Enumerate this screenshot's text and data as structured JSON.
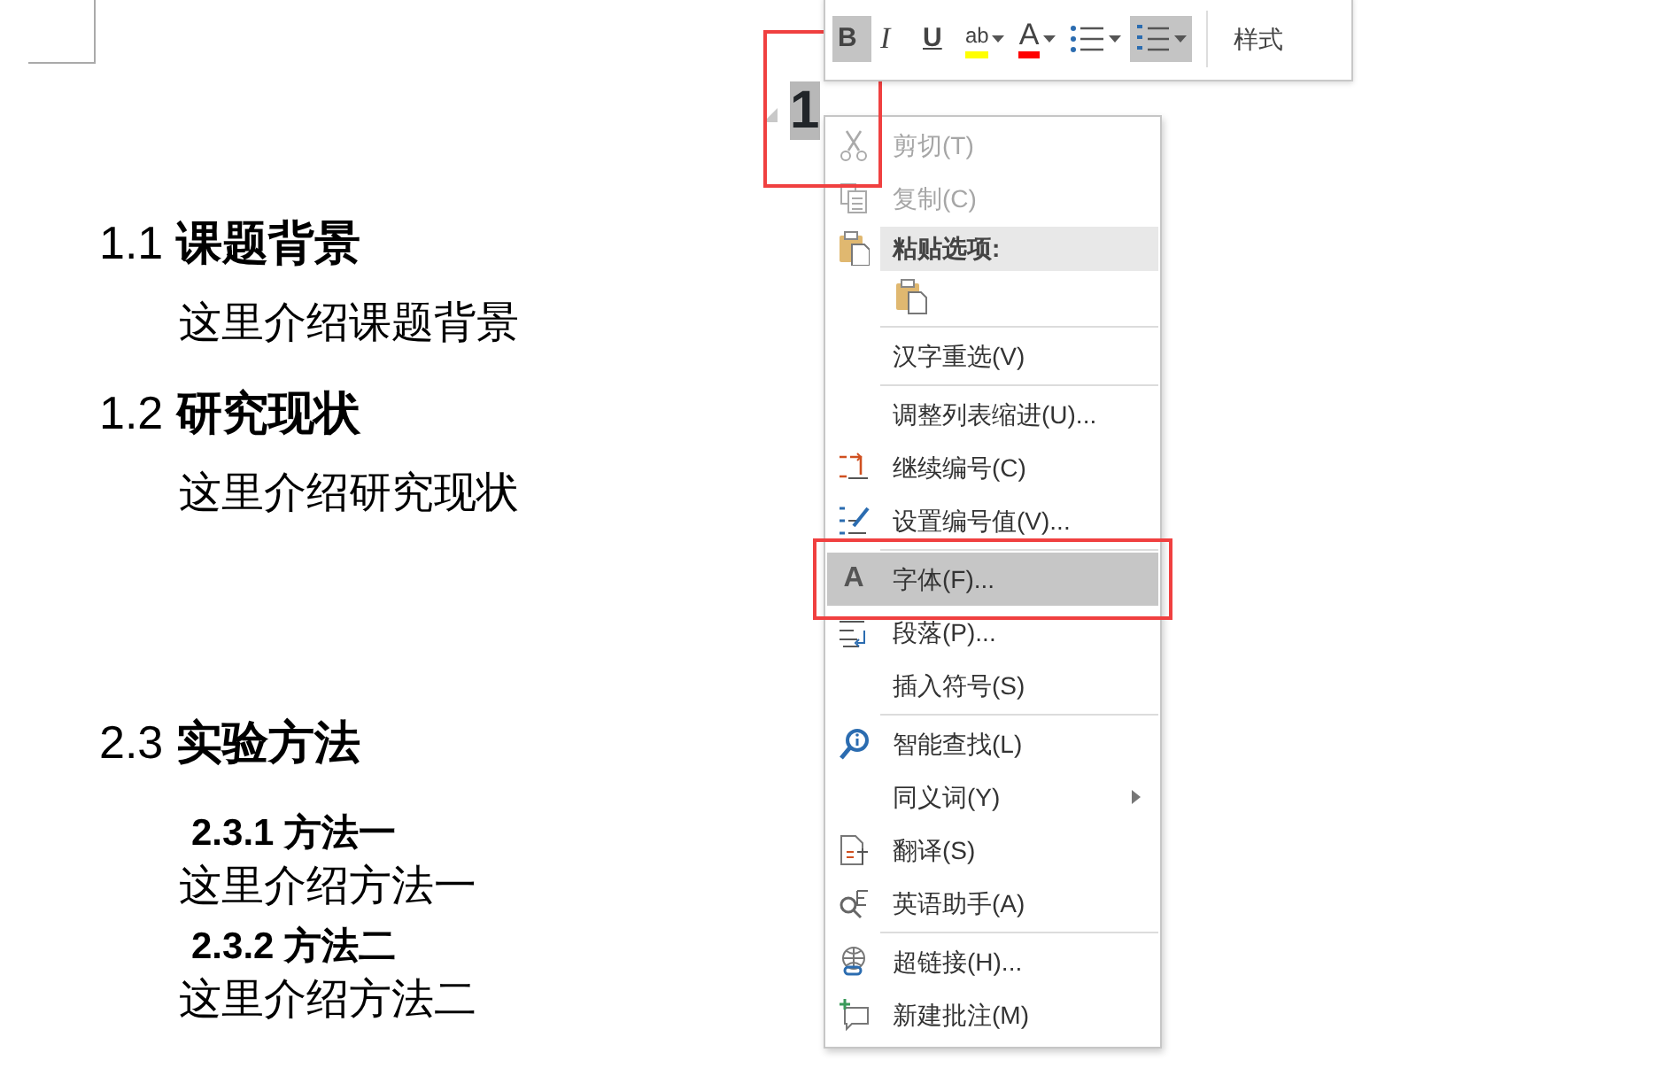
{
  "document": {
    "chapter_heading": {
      "number": "1",
      "selected": true,
      "framed": true
    },
    "sections": [
      {
        "blocks": [
          {
            "kind": "heading",
            "number": "1.1",
            "title": "课题背景"
          },
          {
            "kind": "body",
            "text": "这里介绍课题背景"
          },
          {
            "kind": "heading",
            "number": "1.2",
            "title": "研究现状"
          },
          {
            "kind": "body",
            "text": "这里介绍研究现状"
          }
        ]
      },
      {
        "blocks": [
          {
            "kind": "heading",
            "number": "2.3",
            "title": "实验方法"
          },
          {
            "kind": "subheading",
            "number": "2.3.1",
            "title": "方法一"
          },
          {
            "kind": "body",
            "text": "这里介绍方法一"
          },
          {
            "kind": "subheading",
            "number": "2.3.2",
            "title": "方法二"
          },
          {
            "kind": "body",
            "text": "这里介绍方法二"
          }
        ]
      }
    ]
  },
  "mini_toolbar": {
    "buttons": [
      {
        "kind": "bold",
        "label": "B",
        "selected": true
      },
      {
        "kind": "italic",
        "label": "I",
        "selected": false
      },
      {
        "kind": "underline",
        "label": "U",
        "selected": false
      },
      {
        "kind": "highlight",
        "label": "ab",
        "color": "#ffff00",
        "dropdown": true,
        "selected": false
      },
      {
        "kind": "fontcolor",
        "label": "A",
        "color": "#ff0000",
        "dropdown": true,
        "selected": false
      },
      {
        "kind": "bullets",
        "dropdown": true,
        "selected": false
      },
      {
        "kind": "numbering",
        "dropdown": true,
        "selected": true
      },
      {
        "kind": "styles",
        "label": "样式",
        "selected": false
      }
    ]
  },
  "context_menu": {
    "items": [
      {
        "kind": "item",
        "label": "剪切(T)",
        "disabled": true,
        "selected": false
      },
      {
        "kind": "item",
        "label": "复制(C)",
        "disabled": true,
        "selected": false
      },
      {
        "kind": "header",
        "label": "粘贴选项:"
      },
      {
        "kind": "paste"
      },
      {
        "kind": "separator"
      },
      {
        "kind": "item",
        "label": "汉字重选(V)",
        "disabled": false,
        "selected": false
      },
      {
        "kind": "separator"
      },
      {
        "kind": "item",
        "label": "调整列表缩进(U)...",
        "disabled": false,
        "selected": false
      },
      {
        "kind": "item",
        "label": "继续编号(C)",
        "disabled": false,
        "selected": false
      },
      {
        "kind": "item",
        "label": "设置编号值(V)...",
        "disabled": false,
        "selected": false
      },
      {
        "kind": "separator"
      },
      {
        "kind": "item",
        "label": "字体(F)...",
        "icon_text": "A",
        "disabled": false,
        "selected": true,
        "framed": true
      },
      {
        "kind": "item",
        "label": "段落(P)...",
        "disabled": false,
        "selected": false
      },
      {
        "kind": "item",
        "label": "插入符号(S)",
        "disabled": false,
        "selected": false
      },
      {
        "kind": "separator"
      },
      {
        "kind": "item",
        "label": "智能查找(L)",
        "disabled": false,
        "selected": false
      },
      {
        "kind": "item",
        "label": "同义词(Y)",
        "disabled": false,
        "selected": false,
        "submenu": true
      },
      {
        "kind": "item",
        "label": "翻译(S)",
        "disabled": false,
        "selected": false
      },
      {
        "kind": "item",
        "label": "英语助手(A)",
        "disabled": false,
        "selected": false
      },
      {
        "kind": "separator"
      },
      {
        "kind": "item",
        "label": "超链接(H)...",
        "disabled": false,
        "selected": false
      },
      {
        "kind": "item",
        "label": "新建批注(M)",
        "disabled": false,
        "selected": false
      }
    ]
  }
}
